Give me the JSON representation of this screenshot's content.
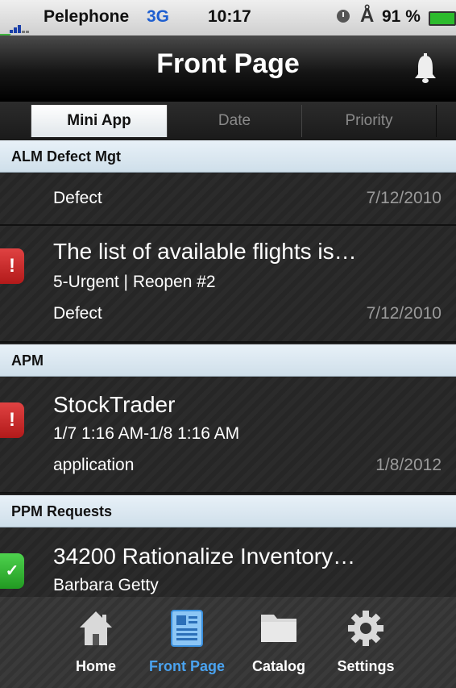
{
  "status": {
    "carrier": "Pelephone",
    "network": "3G",
    "time": "10:17",
    "battery": "91 %"
  },
  "nav": {
    "title": "Front Page",
    "icon": "bell-icon"
  },
  "tabs": [
    {
      "label": "Mini App",
      "active": true
    },
    {
      "label": "Date",
      "active": false
    },
    {
      "label": "Priority",
      "active": false
    }
  ],
  "sections": {
    "alm": {
      "header": "ALM Defect Mgt",
      "partial_row": {
        "type": "Defect",
        "date": "7/12/2010"
      },
      "row": {
        "title": "The list of available flights is…",
        "sub": "5-Urgent | Reopen #2",
        "type": "Defect",
        "date": "7/12/2010",
        "badge": "!"
      }
    },
    "apm": {
      "header": "APM",
      "row": {
        "title": "StockTrader",
        "sub": "1/7 1:16 AM-1/8 1:16 AM",
        "type": "application",
        "date": "1/8/2012",
        "badge": "!"
      }
    },
    "ppm": {
      "header": "PPM Requests",
      "row": {
        "title": "34200 Rationalize Inventory…",
        "sub": "Barbara Getty",
        "badge": "✓"
      }
    }
  },
  "tabbar": [
    {
      "label": "Home",
      "icon": "home-icon",
      "active": false
    },
    {
      "label": "Front Page",
      "icon": "newspaper-icon",
      "active": true
    },
    {
      "label": "Catalog",
      "icon": "folder-icon",
      "active": false
    },
    {
      "label": "Settings",
      "icon": "gear-icon",
      "active": false
    }
  ],
  "colors": {
    "accent": "#4aa3f0",
    "urgent": "#c62828",
    "ok": "#2fb52f"
  }
}
